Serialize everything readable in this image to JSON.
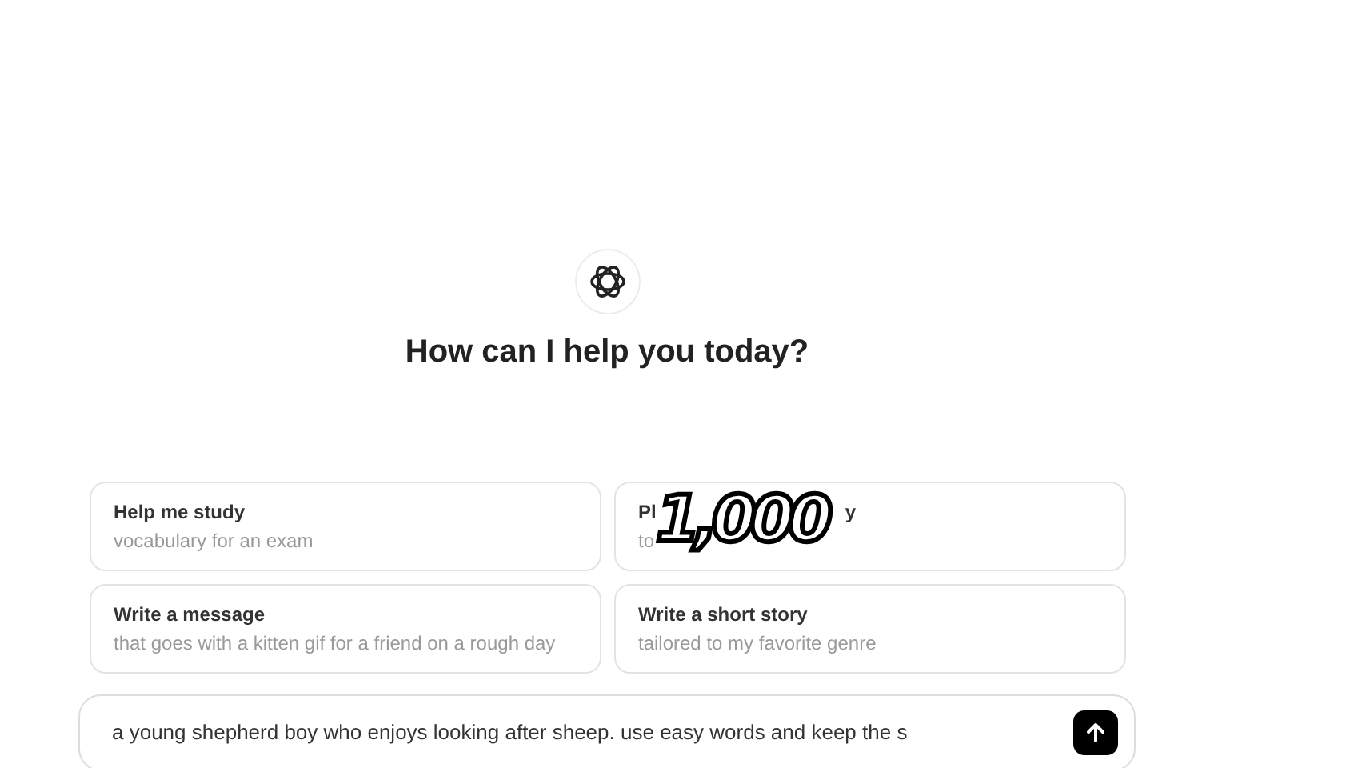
{
  "heading": "How can I help you today?",
  "suggestions": [
    {
      "title_parts": [
        "Help me study"
      ],
      "subtitle_parts": [
        "vocabulary for an exam"
      ]
    },
    {
      "title_parts": [
        "Pl",
        "y"
      ],
      "subtitle_parts": [
        "to"
      ]
    },
    {
      "title_parts": [
        "Write a message"
      ],
      "subtitle_parts": [
        "that goes with a kitten gif for a friend on a rough day"
      ]
    },
    {
      "title_parts": [
        "Write a short story"
      ],
      "subtitle_parts": [
        "tailored to my favorite genre"
      ]
    }
  ],
  "composer": {
    "value": "a young shepherd boy who enjoys looking after sheep. use easy words and keep the s"
  },
  "overlay": {
    "text": "1,000"
  }
}
